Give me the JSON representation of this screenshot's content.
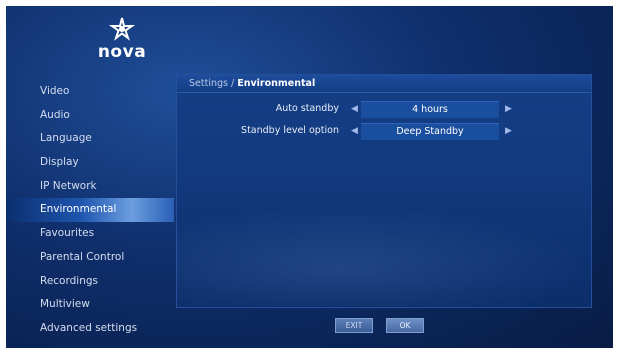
{
  "brand": {
    "name": "nova"
  },
  "sidebar": {
    "items": [
      {
        "label": "Video"
      },
      {
        "label": "Audio"
      },
      {
        "label": "Language"
      },
      {
        "label": "Display"
      },
      {
        "label": "IP Network"
      },
      {
        "label": "Environmental",
        "active": true
      },
      {
        "label": "Favourites"
      },
      {
        "label": "Parental Control"
      },
      {
        "label": "Recordings"
      },
      {
        "label": "Multiview"
      },
      {
        "label": "Advanced settings"
      }
    ]
  },
  "panel": {
    "breadcrumb_root": "Settings",
    "breadcrumb_sep": " / ",
    "breadcrumb_current": "Environmental",
    "rows": [
      {
        "label": "Auto standby",
        "value": "4 hours"
      },
      {
        "label": "Standby level option",
        "value": "Deep Standby"
      }
    ]
  },
  "footer": {
    "exit_label": "EXIT",
    "ok_label": "OK"
  },
  "colors": {
    "background": "#0f2e6b",
    "active_highlight": "#6c9ee0",
    "value_box": "#1a4e9e"
  },
  "icons": {
    "logo": "nova-star-logo-icon",
    "left": "arrow-left-icon",
    "right": "arrow-right-icon"
  }
}
